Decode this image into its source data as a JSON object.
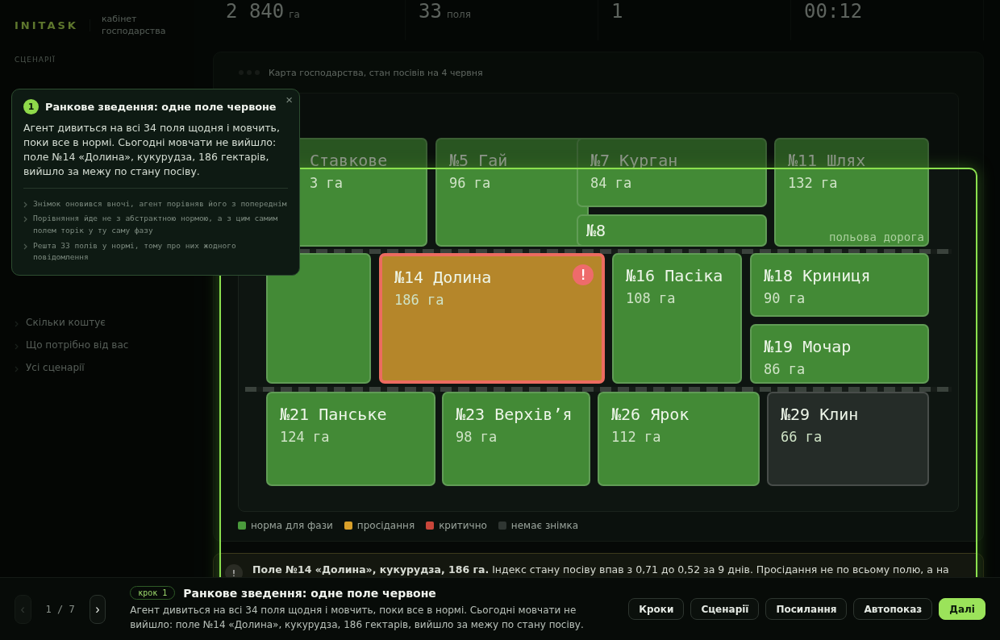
{
  "sidebar": {
    "logo": "INITASK",
    "subtitle": "кабінет господарства",
    "section": "СЦЕНАРІЇ",
    "items": [
      "Скільки коштує",
      "Що потрібно від вас",
      "Усі сценарії"
    ]
  },
  "stats": [
    {
      "value": "2 840",
      "unit": "га"
    },
    {
      "value": "33",
      "unit": "поля"
    },
    {
      "value": "1"
    },
    {
      "value": "00:12"
    }
  ],
  "map": {
    "title": "Карта господарства, стан посівів на 4 червня",
    "road_label": "польова дорога",
    "fields": [
      {
        "name": "Ставкове",
        "area": "3 га",
        "color": "#438a36",
        "alert": false
      },
      {
        "name": "№5 Гай",
        "area": "96 га",
        "color": "#438a36",
        "alert": false
      },
      {
        "name": "№7 Курган",
        "area": "84 га",
        "color": "#438a36",
        "alert": false
      },
      {
        "name": "№8",
        "color": "#438a36",
        "alert": false
      },
      {
        "name": "№11 Шлях",
        "area": "132 га",
        "color": "#438a36",
        "alert": false
      },
      {
        "color": "#438a36",
        "alert": false
      },
      {
        "name": "№14 Долина",
        "area": "186 га",
        "color": "#b5862a",
        "alert": true
      },
      {
        "name": "№16 Пасіка",
        "area": "108 га",
        "color": "#438a36",
        "alert": false
      },
      {
        "name": "№18 Криниця",
        "area": "90 га",
        "color": "#438a36",
        "alert": false
      },
      {
        "name": "№19 Мочар",
        "area": "86 га",
        "color": "#438a36",
        "alert": false
      },
      {
        "name": "№21 Панське",
        "area": "124 га",
        "color": "#438a36",
        "alert": false
      },
      {
        "name": "№23 Верхів’я",
        "area": "98 га",
        "color": "#438a36",
        "alert": false
      },
      {
        "name": "№26 Ярок",
        "area": "112 га",
        "color": "#438a36",
        "alert": false
      },
      {
        "name": "№29 Клин",
        "area": "66 га",
        "color": "#252c28",
        "alert": false
      }
    ],
    "alert_mark": "!",
    "legend": [
      {
        "label": "норма для фази",
        "color": "#4a9a3c"
      },
      {
        "label": "просідання",
        "color": "#d9a02a"
      },
      {
        "label": "критично",
        "color": "#c8463a"
      },
      {
        "label": "немає знімка",
        "color": "#2f3632"
      }
    ]
  },
  "alert": {
    "icon": "!",
    "text": "**Поле №14 «Долина», кукурудза, 186 га.** Індекс стану посіву впав з 0,71 до 0,52 за 9 днів. Просідання не по всьому полю, а на"
  },
  "tooltip": {
    "number": "1",
    "title": "Ранкове зведення: одне поле червоне",
    "close": "×",
    "body": "Агент дивиться на всі 34 поля щодня і мовчить, поки все в нормі. Сьогодні мовчати не вийшло: поле №14 «Долина», кукурудза, 186 гектарів, вийшло за межу по стану посіву.",
    "bullets": [
      "Знімок оновився вночі, агент порівняв його з попереднім",
      "Порівняння йде не з абстрактною нормою, а з цим самим полем торік у ту саму фазу",
      "Решта 33 полів у нормі, тому про них жодного повідомлення"
    ]
  },
  "bottom_bar": {
    "prev": {
      "label": "‹",
      "disabled": true
    },
    "counter": "1 / 7",
    "next": {
      "label": "›",
      "disabled": false
    },
    "step": "крок 1",
    "title": "Ранкове зведення: одне поле червоне",
    "text": "Агент дивиться на всі 34 поля щодня і мовчить, поки все в нормі. Сьогодні мовчати не вийшло: поле №14 «Долина», кукурудза, 186 гектарів, вийшло за межу по стану посіву.",
    "buttons": [
      {
        "label": "Кроки",
        "primary": false
      },
      {
        "label": "Сценарії",
        "primary": false
      },
      {
        "label": "Посилання",
        "primary": false
      },
      {
        "label": "Автопоказ",
        "primary": false
      },
      {
        "label": "Далі",
        "primary": true
      }
    ]
  }
}
